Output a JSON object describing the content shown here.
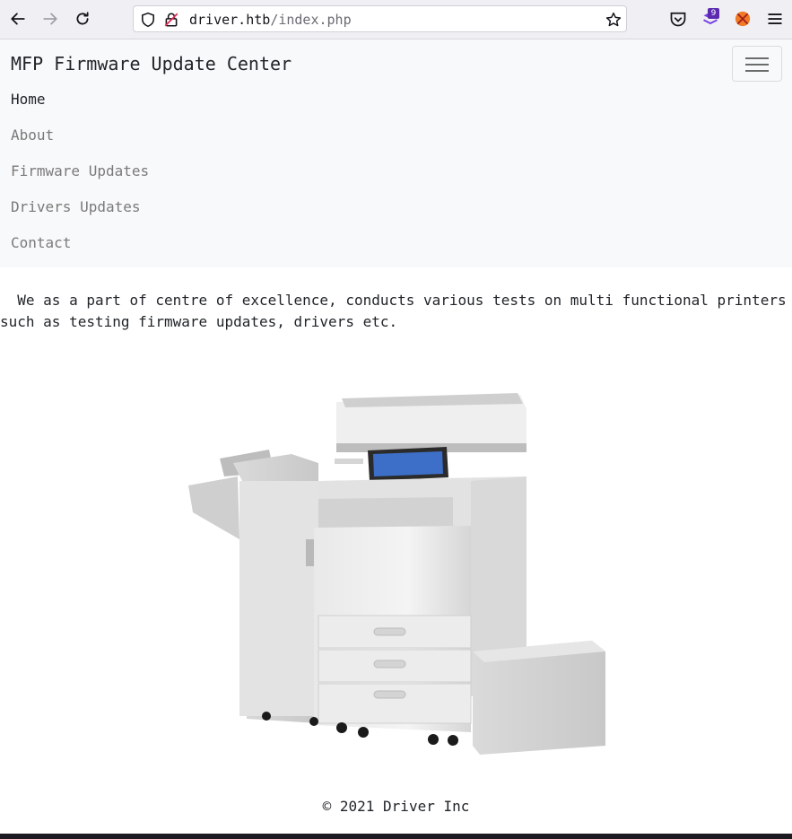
{
  "browser": {
    "url_host": "driver.htb",
    "url_path": "/index.php",
    "extension_badge": "9"
  },
  "navbar": {
    "brand": "MFP Firmware Update Center",
    "items": [
      {
        "label": "Home",
        "active": true
      },
      {
        "label": "About",
        "active": false
      },
      {
        "label": "Firmware Updates",
        "active": false
      },
      {
        "label": "Drivers Updates",
        "active": false
      },
      {
        "label": "Contact",
        "active": false
      }
    ]
  },
  "main": {
    "intro_line1": "  We as a part of centre of excellence, conducts various tests on multi functional printers",
    "intro_line2": "such as testing firmware updates, drivers etc."
  },
  "footer": {
    "copyright": "© 2021 Driver Inc"
  }
}
